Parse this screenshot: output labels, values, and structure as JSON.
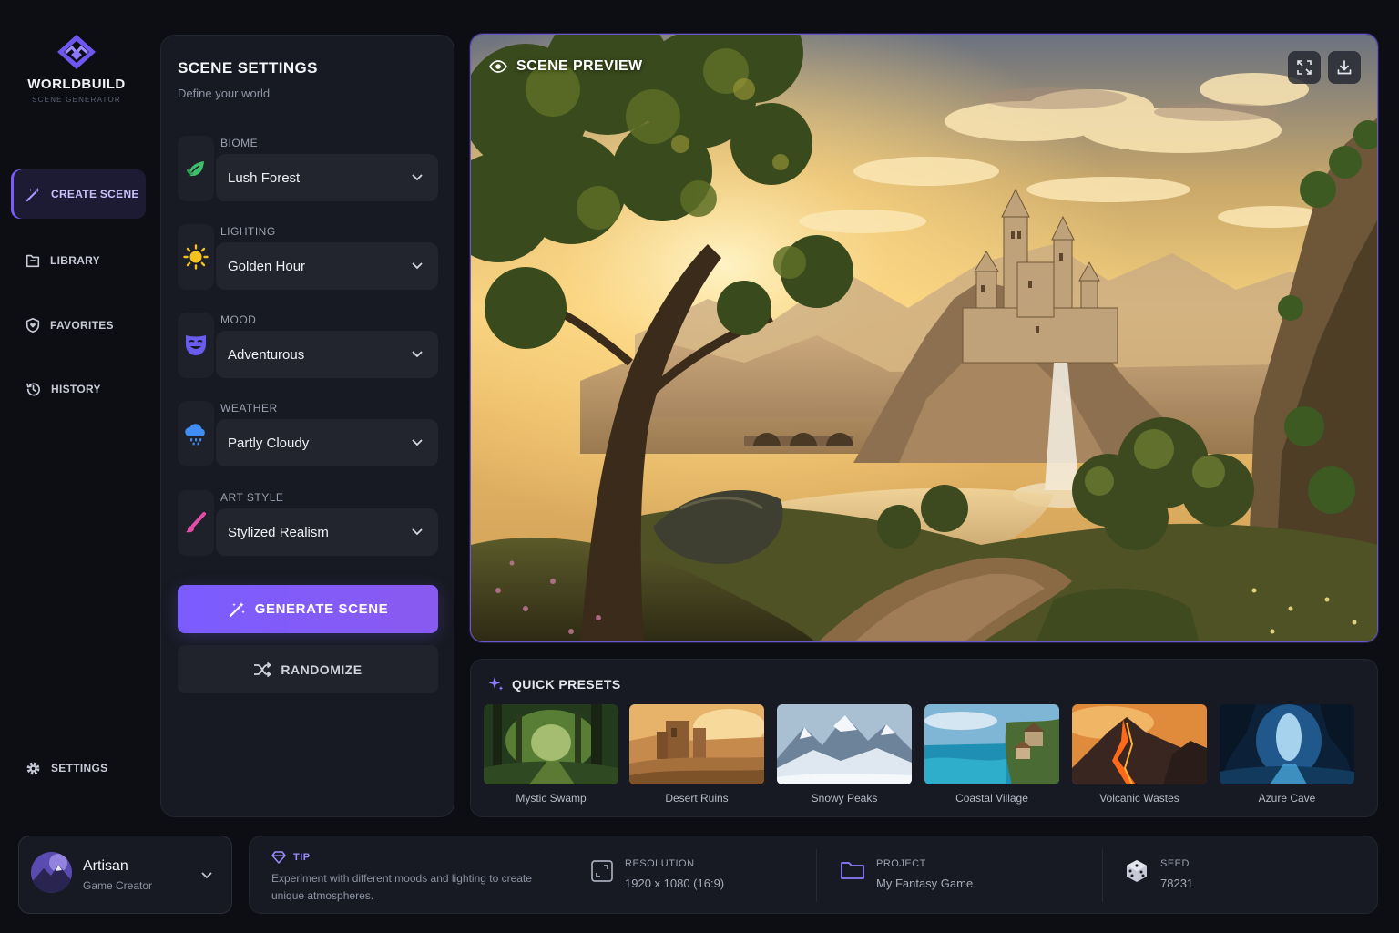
{
  "brand": {
    "name": "WORLDBUILD",
    "tagline": "SCENE GENERATOR",
    "accent": "#7c5cff"
  },
  "nav": {
    "items": [
      {
        "label": "CREATE SCENE",
        "icon": "magic-wand-icon",
        "active": true
      },
      {
        "label": "LIBRARY",
        "icon": "folder-icon",
        "active": false
      },
      {
        "label": "FAVORITES",
        "icon": "shield-heart-icon",
        "active": false
      },
      {
        "label": "HISTORY",
        "icon": "history-icon",
        "active": false
      }
    ],
    "settings_label": "SETTINGS"
  },
  "panel": {
    "title": "SCENE SETTINGS",
    "subtitle": "Define your world",
    "settings": [
      {
        "label": "BIOME",
        "value": "Lush Forest",
        "icon": "leaf-icon",
        "color": "#3fbf6a"
      },
      {
        "label": "LIGHTING",
        "value": "Golden Hour",
        "icon": "sun-icon",
        "color": "#f6c21c"
      },
      {
        "label": "MOOD",
        "value": "Adventurous",
        "icon": "theater-mask-icon",
        "color": "#6b5cf0"
      },
      {
        "label": "WEATHER",
        "value": "Partly Cloudy",
        "icon": "rain-cloud-icon",
        "color": "#3f8df5"
      },
      {
        "label": "ART STYLE",
        "value": "Stylized Realism",
        "icon": "paintbrush-icon",
        "color": "#e04ea8"
      }
    ],
    "generate_label": "GENERATE SCENE",
    "randomize_label": "RANDOMIZE"
  },
  "preview": {
    "title": "SCENE PREVIEW",
    "scene": "fantasy castle on cliffs at golden hour with waterfall, forest path and mountains"
  },
  "presets": {
    "title": "QUICK PRESETS",
    "items": [
      {
        "label": "Mystic Swamp"
      },
      {
        "label": "Desert Ruins"
      },
      {
        "label": "Snowy Peaks"
      },
      {
        "label": "Coastal Village"
      },
      {
        "label": "Volcanic Wastes"
      },
      {
        "label": "Azure Cave"
      }
    ]
  },
  "user": {
    "name": "Artisan",
    "role": "Game Creator"
  },
  "info": {
    "tip_label": "TIP",
    "tip_text": "Experiment with different moods and lighting to create unique atmospheres.",
    "resolution_label": "RESOLUTION",
    "resolution_value": "1920 x 1080 (16:9)",
    "project_label": "PROJECT",
    "project_value": "My Fantasy Game",
    "seed_label": "SEED",
    "seed_value": "78231"
  }
}
